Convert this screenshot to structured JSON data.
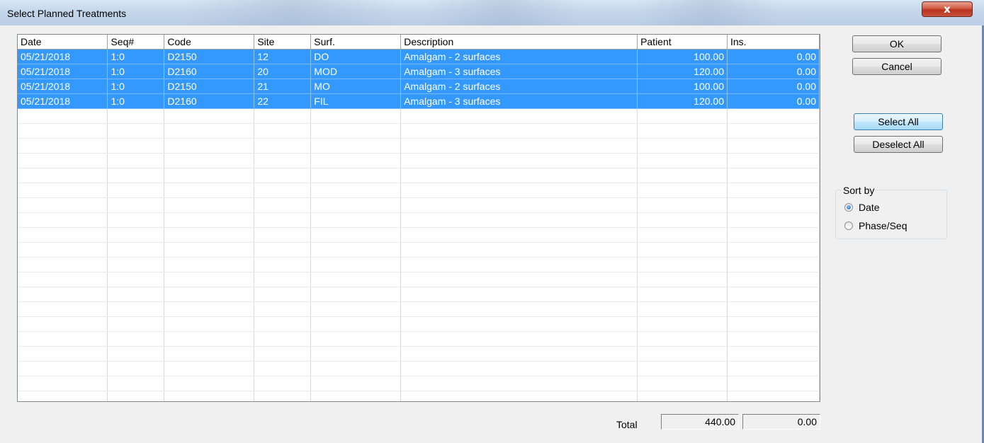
{
  "window": {
    "title": "Select Planned Treatments",
    "close_label": "x"
  },
  "grid": {
    "columns": [
      "Date",
      "Seq#",
      "Code",
      "Site",
      "Surf.",
      "Description",
      "Patient",
      "Ins."
    ],
    "rows": [
      {
        "date": "05/21/2018",
        "seq": "1:0",
        "code": "D2150",
        "site": "12",
        "surf": "DO",
        "description": "Amalgam - 2 surfaces",
        "patient": "100.00",
        "ins": "0.00",
        "selected": true
      },
      {
        "date": "05/21/2018",
        "seq": "1:0",
        "code": "D2160",
        "site": "20",
        "surf": "MOD",
        "description": "Amalgam - 3 surfaces",
        "patient": "120.00",
        "ins": "0.00",
        "selected": true
      },
      {
        "date": "05/21/2018",
        "seq": "1:0",
        "code": "D2150",
        "site": "21",
        "surf": "MO",
        "description": "Amalgam - 2 surfaces",
        "patient": "100.00",
        "ins": "0.00",
        "selected": true
      },
      {
        "date": "05/21/2018",
        "seq": "1:0",
        "code": "D2160",
        "site": "22",
        "surf": "FIL",
        "description": "Amalgam - 3 surfaces",
        "patient": "120.00",
        "ins": "0.00",
        "selected": true
      }
    ]
  },
  "buttons": {
    "ok": "OK",
    "cancel": "Cancel",
    "select_all": "Select All",
    "deselect_all": "Deselect All"
  },
  "sort_by": {
    "label": "Sort by",
    "options": [
      {
        "label": "Date",
        "checked": true
      },
      {
        "label": "Phase/Seq",
        "checked": false
      }
    ]
  },
  "totals": {
    "label": "Total",
    "patient": "440.00",
    "ins": "0.00"
  },
  "colors": {
    "selection": "#3399ff",
    "title_bar": "#c5d8ec"
  }
}
